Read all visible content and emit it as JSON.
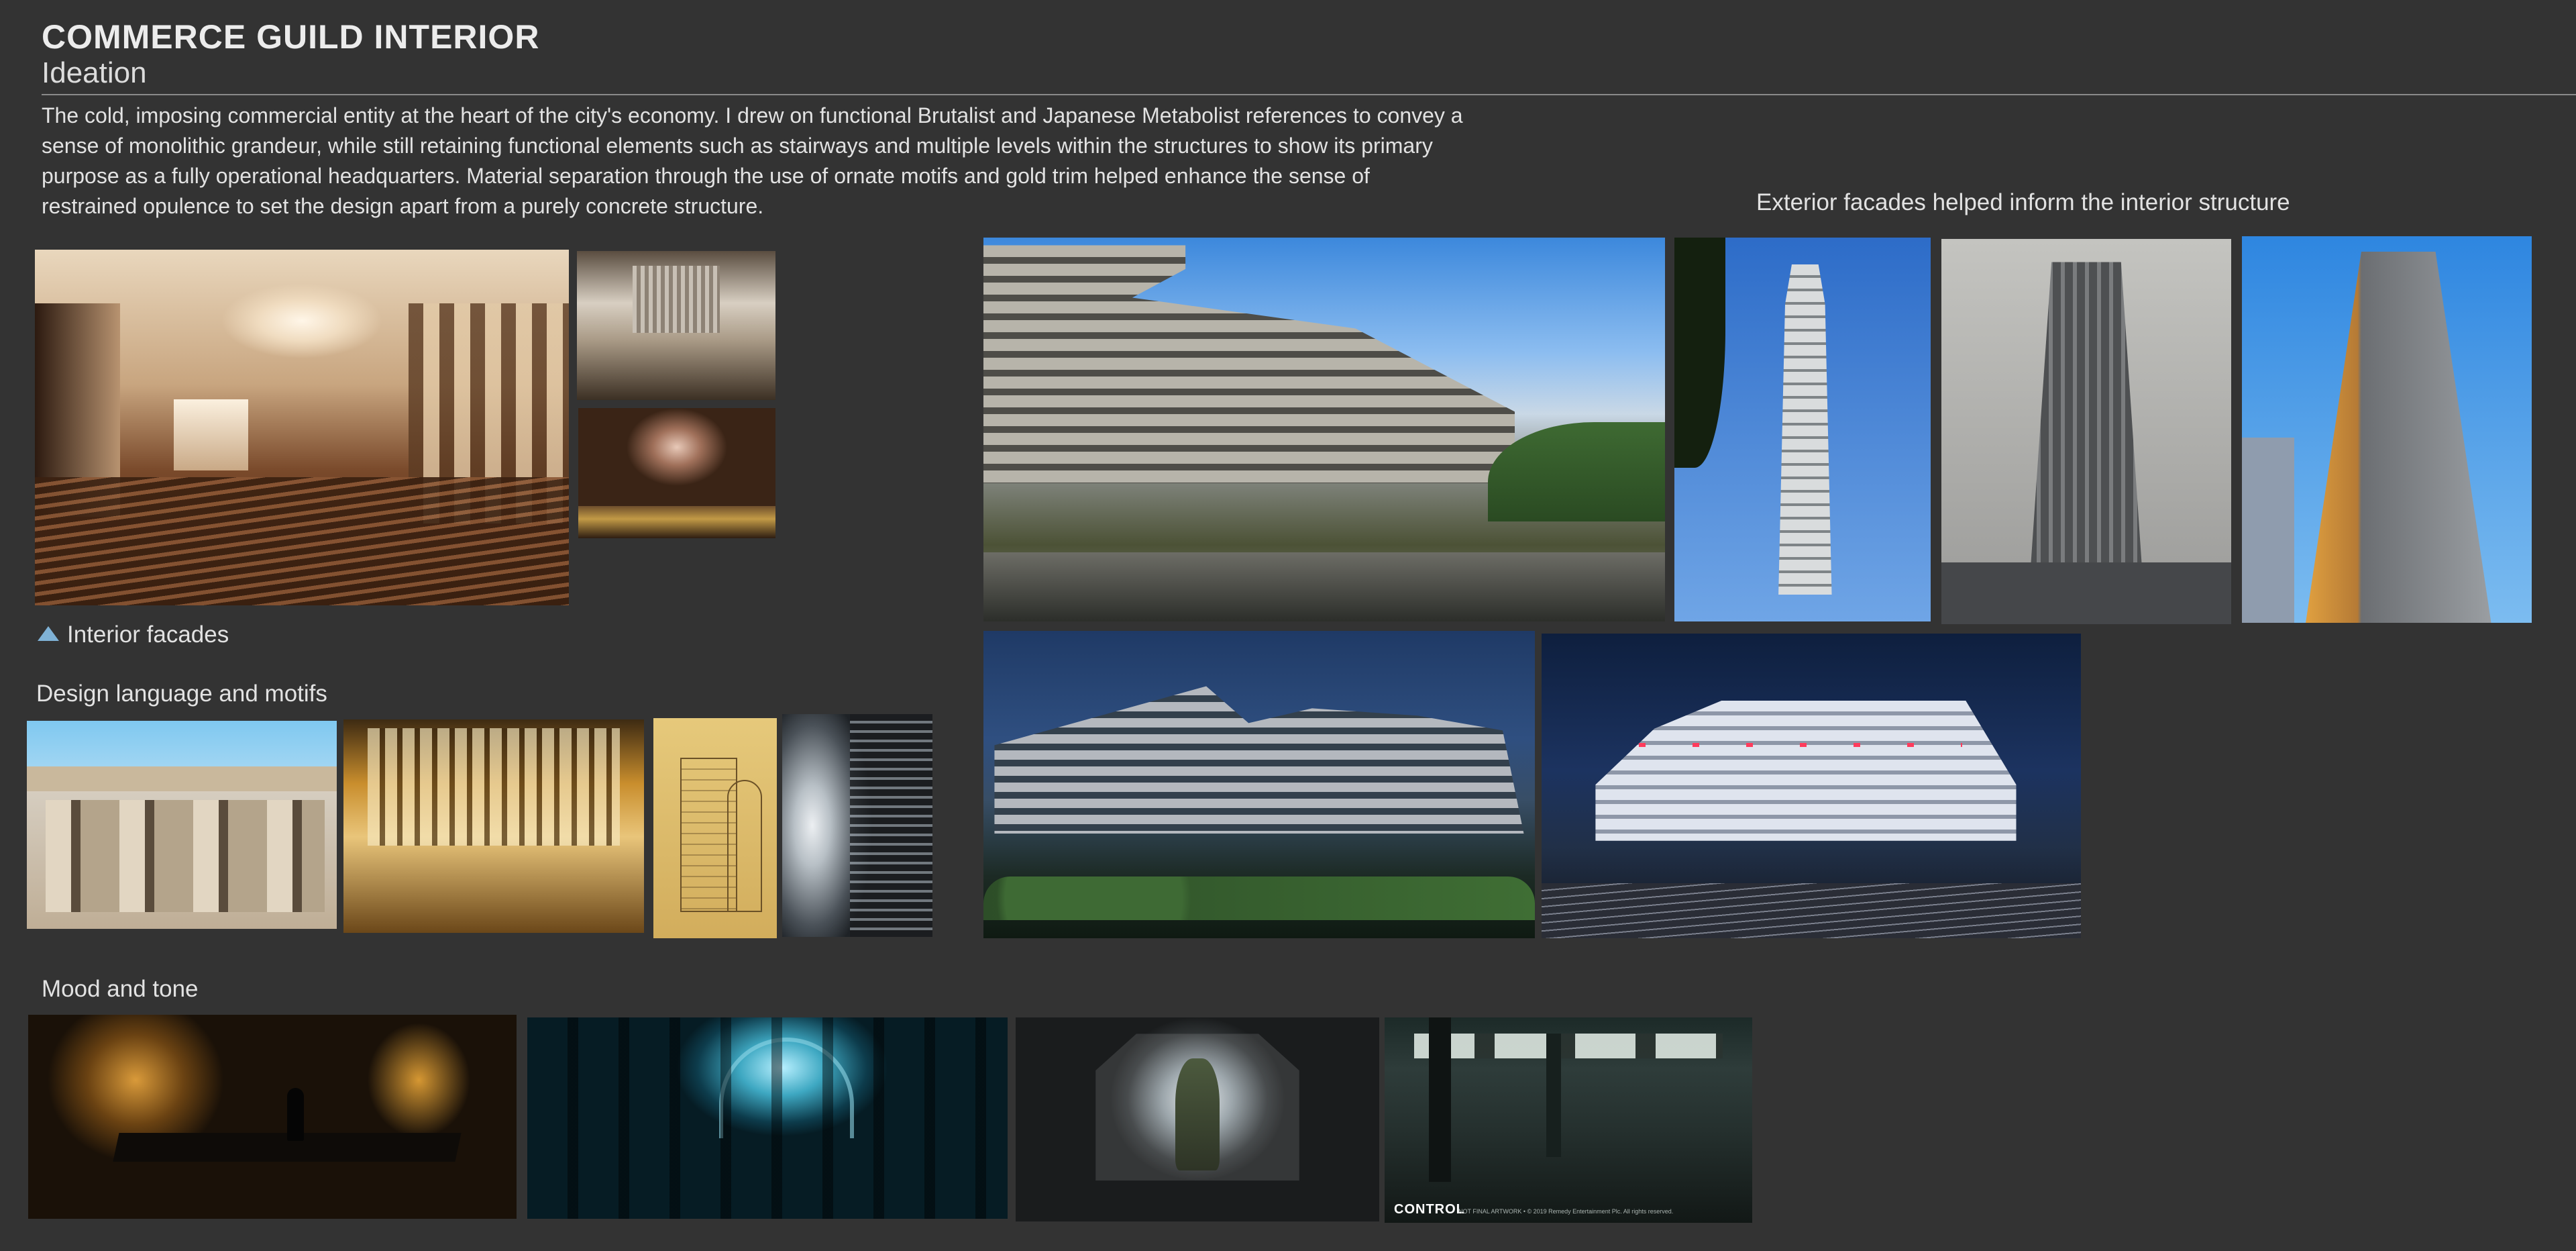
{
  "header": {
    "title": "COMMERCE GUILD INTERIOR",
    "subtitle": "Ideation",
    "description": "The cold, imposing commercial entity at the heart of the city's economy. I drew on functional Brutalist and Japanese Metabolist references to convey a sense of monolithic grandeur, while still retaining functional elements such as stairways and multiple levels within the structures to show its primary purpose as a fully operational headquarters. Material separation through the use of ornate motifs and gold trim helped enhance the sense of restrained opulence to set the design apart from a purely concrete structure."
  },
  "sections": {
    "interior_facades": "Interior facades",
    "design_language": "Design language and motifs",
    "exterior_facades": "Exterior facades helped inform the interior structure",
    "mood": "Mood and tone"
  },
  "mood_image_overlay": {
    "logo": "CONTROL",
    "fine_print": "NOT FINAL ARTWORK • © 2019 Remedy Entertainment Plc. All rights reserved."
  },
  "colors": {
    "background": "#333333",
    "text": "#e6e6e6",
    "accent_caret": "#7fb2d6"
  },
  "icons": {
    "interior_label": "caret-up-icon"
  }
}
